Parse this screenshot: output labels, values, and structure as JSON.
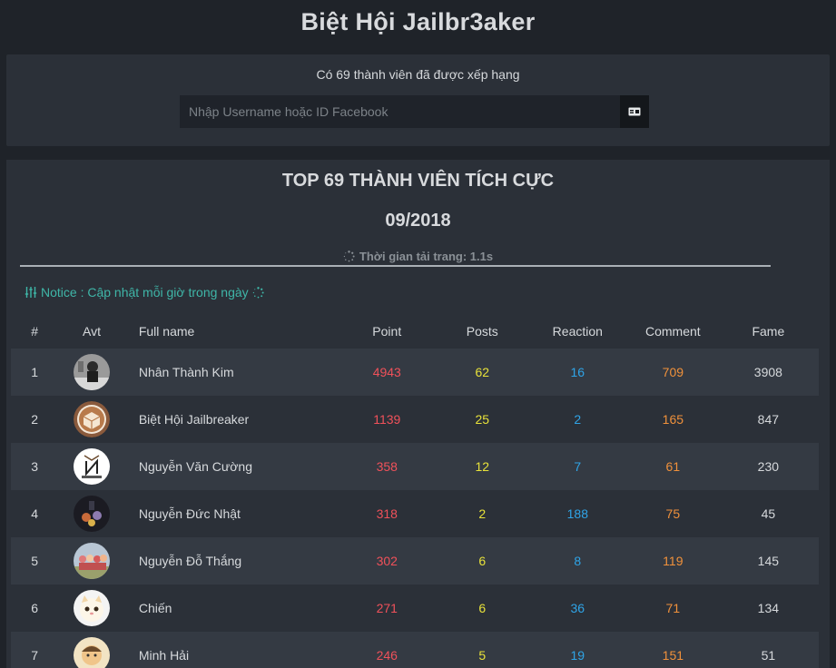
{
  "header": {
    "title": "Biệt Hội Jailbr3aker"
  },
  "search": {
    "ranked_text": "Có 69 thành viên đã được xếp hạng",
    "placeholder": "Nhập Username hoặc ID Facebook",
    "button_icon": "id-card-icon"
  },
  "leaderboard": {
    "title": "TOP 69 THÀNH VIÊN TÍCH CỰC",
    "month": "09/2018",
    "load_time": "Thời gian tải trang: 1.1s",
    "notice": "Notice : Cập nhật mỗi giờ trong ngày",
    "columns": [
      "#",
      "Avt",
      "Full name",
      "Point",
      "Posts",
      "Reaction",
      "Comment",
      "Fame"
    ],
    "rows": [
      {
        "rank": "1",
        "name": "Nhân Thành Kim",
        "point": "4943",
        "posts": "62",
        "reaction": "16",
        "comment": "709",
        "fame": "3908"
      },
      {
        "rank": "2",
        "name": "Biệt Hội Jailbreaker",
        "point": "1139",
        "posts": "25",
        "reaction": "2",
        "comment": "165",
        "fame": "847"
      },
      {
        "rank": "3",
        "name": "Nguyễn Văn Cường",
        "point": "358",
        "posts": "12",
        "reaction": "7",
        "comment": "61",
        "fame": "230"
      },
      {
        "rank": "4",
        "name": "Nguyễn Đức Nhật",
        "point": "318",
        "posts": "2",
        "reaction": "188",
        "comment": "75",
        "fame": "45"
      },
      {
        "rank": "5",
        "name": "Nguyễn Đỗ Thắng",
        "point": "302",
        "posts": "6",
        "reaction": "8",
        "comment": "119",
        "fame": "145"
      },
      {
        "rank": "6",
        "name": "Chiến",
        "point": "271",
        "posts": "6",
        "reaction": "36",
        "comment": "71",
        "fame": "134"
      },
      {
        "rank": "7",
        "name": "Minh Hải",
        "point": "246",
        "posts": "5",
        "reaction": "19",
        "comment": "151",
        "fame": "51"
      }
    ]
  },
  "colors": {
    "point": "#f0515a",
    "posts": "#e8e23a",
    "reaction": "#2fa4e7",
    "comment": "#f0913b",
    "notice": "#3fb6a8"
  }
}
